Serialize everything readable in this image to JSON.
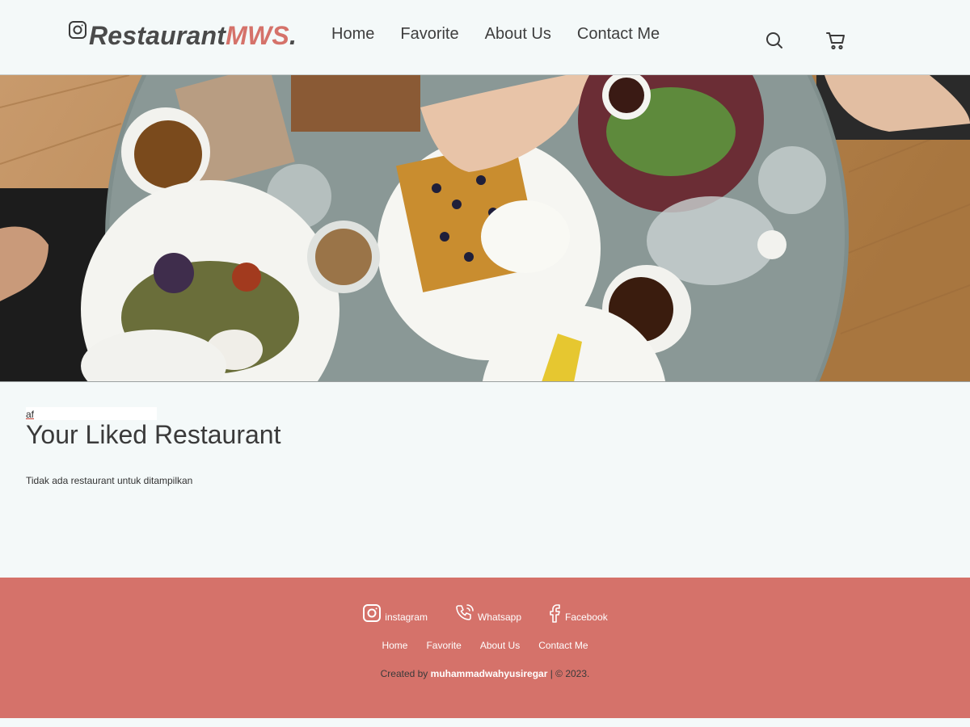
{
  "header": {
    "logo_part1": "Restaurant",
    "logo_part2": "MWS",
    "logo_dot": ".",
    "nav": [
      {
        "label": "Home"
      },
      {
        "label": "Favorite"
      },
      {
        "label": "About Us"
      },
      {
        "label": "Contact Me"
      }
    ],
    "icons": {
      "logo": "instagram-icon",
      "search": "search-icon",
      "cart": "cart-icon"
    }
  },
  "hero": {
    "alt": "Overhead view of a breakfast table with waffles, coffee and plates"
  },
  "main": {
    "skip_text": "af",
    "title": "Your Liked Restaurant",
    "empty_message": "Tidak ada restaurant untuk ditampilkan"
  },
  "footer": {
    "social": [
      {
        "label": "instagram",
        "icon": "instagram-icon"
      },
      {
        "label": "Whatsapp",
        "icon": "phone-icon"
      },
      {
        "label": "Facebook",
        "icon": "facebook-icon"
      }
    ],
    "links": [
      {
        "label": "Home"
      },
      {
        "label": "Favorite"
      },
      {
        "label": "About Us"
      },
      {
        "label": "Contact Me"
      }
    ],
    "credit_prefix": "Created by ",
    "credit_author": "muhammadwahyusiregar",
    "credit_suffix": " | © 2023."
  },
  "colors": {
    "accent": "#d5726a",
    "background": "#f4f9f9",
    "text": "#3a3a3a"
  }
}
